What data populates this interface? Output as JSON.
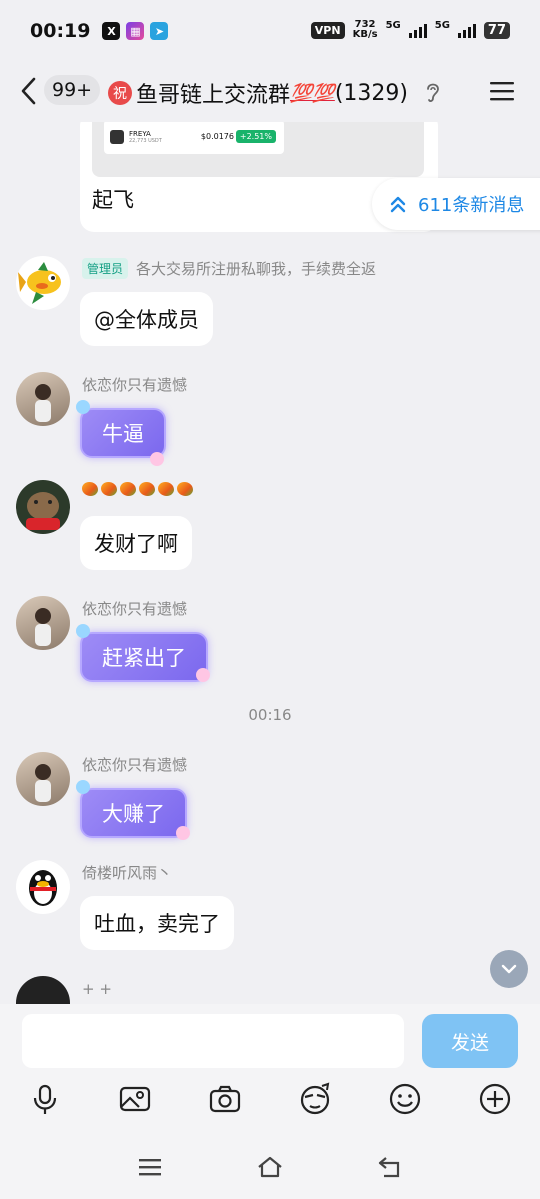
{
  "status": {
    "time": "00:19",
    "vpn": "VPN",
    "speed_value": "732",
    "speed_unit": "KB/s",
    "net1": "5G",
    "net2": "5G",
    "battery": "77"
  },
  "header": {
    "unread_badge": "99+",
    "zhu_char": "祝",
    "title": "鱼哥链上交流群",
    "hundred": "💯💯",
    "member_count": "(1329)"
  },
  "card": {
    "coin_name": "FREYA",
    "coin_sub": "22,773 USDT",
    "coin_price": "$0.0176",
    "coin_change": "+2.51%",
    "text": "起飞"
  },
  "new_messages": "611条新消息",
  "messages": [
    {
      "name": "各大交易所注册私聊我，手续费全返",
      "tag": "管理员",
      "text": "@全体成员"
    },
    {
      "name": "依恋你只有遗憾",
      "sticker": "牛逼"
    },
    {
      "text": "发财了啊"
    },
    {
      "name": "依恋你只有遗憾",
      "sticker": "赶紧出了"
    },
    {
      "name": "依恋你只有遗憾",
      "sticker": "大赚了"
    },
    {
      "name": "倚楼听风雨丶",
      "text": "吐血，卖完了"
    },
    {
      "name": "+ +"
    }
  ],
  "timestamp": "00:16",
  "input": {
    "placeholder": "",
    "send_label": "发送"
  },
  "colors": {
    "accent": "#1e88e5",
    "send_button": "#7fc3f4",
    "admin_tag": "#16a085",
    "background": "#f0f0f3"
  }
}
